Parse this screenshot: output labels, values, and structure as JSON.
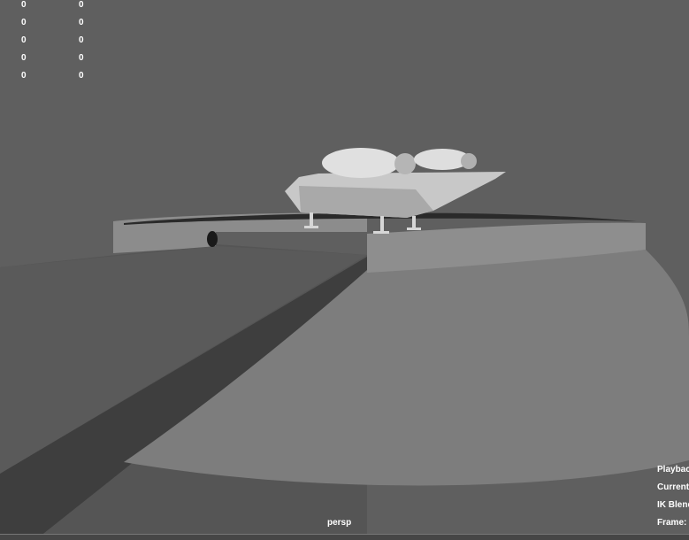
{
  "viewport": {
    "camera": "persp",
    "background_color": "#5f5f5f"
  },
  "hud_stats": {
    "rows": [
      {
        "a": "0",
        "b": "0"
      },
      {
        "a": "0",
        "b": "0"
      },
      {
        "a": "0",
        "b": "0"
      },
      {
        "a": "0",
        "b": "0"
      },
      {
        "a": "0",
        "b": "0"
      }
    ]
  },
  "hud_right": {
    "lines": [
      "Playback",
      "Current",
      "IK Blend",
      "Frame:"
    ]
  }
}
